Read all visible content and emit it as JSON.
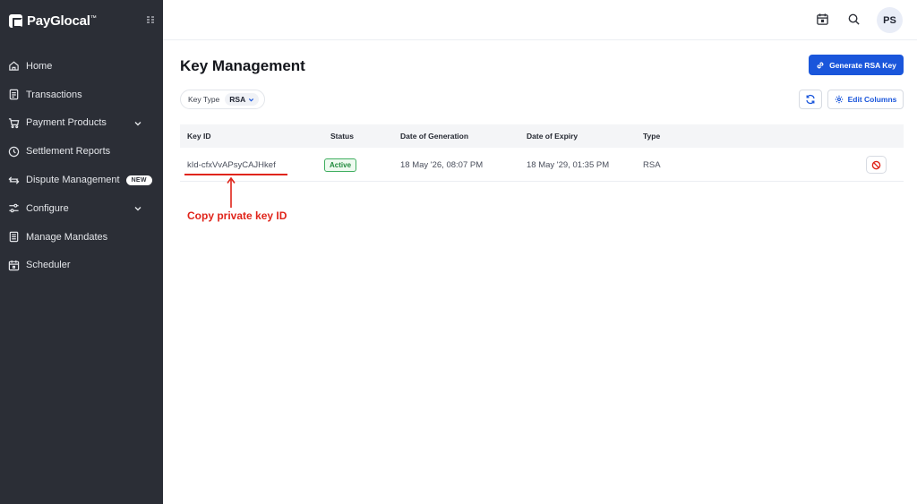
{
  "brand": {
    "name": "PayGlocal",
    "mark": "™"
  },
  "sidebar": {
    "items": [
      {
        "label": "Home",
        "icon": "home-icon"
      },
      {
        "label": "Transactions",
        "icon": "receipt-icon"
      },
      {
        "label": "Payment Products",
        "icon": "cart-icon",
        "expandable": true
      },
      {
        "label": "Settlement Reports",
        "icon": "clock-icon"
      },
      {
        "label": "Dispute Management",
        "icon": "exchange-icon",
        "badge": "NEW"
      },
      {
        "label": "Configure",
        "icon": "sliders-icon",
        "expandable": true
      },
      {
        "label": "Manage Mandates",
        "icon": "document-icon"
      },
      {
        "label": "Scheduler",
        "icon": "calendar-icon"
      }
    ]
  },
  "topbar": {
    "avatar_initials": "PS"
  },
  "page": {
    "title": "Key Management",
    "generate_button": "Generate RSA Key",
    "filter": {
      "label": "Key Type",
      "value": "RSA"
    },
    "edit_columns_button": "Edit Columns"
  },
  "table": {
    "columns": [
      "Key ID",
      "Status",
      "Date of Generation",
      "Date of Expiry",
      "Type"
    ],
    "rows": [
      {
        "key_id": "kId-cfxVvAPsyCAJHkef",
        "status": "Active",
        "generated": "18 May '26, 08:07 PM",
        "expiry": "18 May '29, 01:35 PM",
        "type": "RSA"
      }
    ]
  },
  "annotation": {
    "text": "Copy private key ID",
    "color": "#e0251b"
  },
  "colors": {
    "sidebar_bg": "#2b2e36",
    "primary": "#1a56db",
    "active_green": "#1f8a3c"
  }
}
